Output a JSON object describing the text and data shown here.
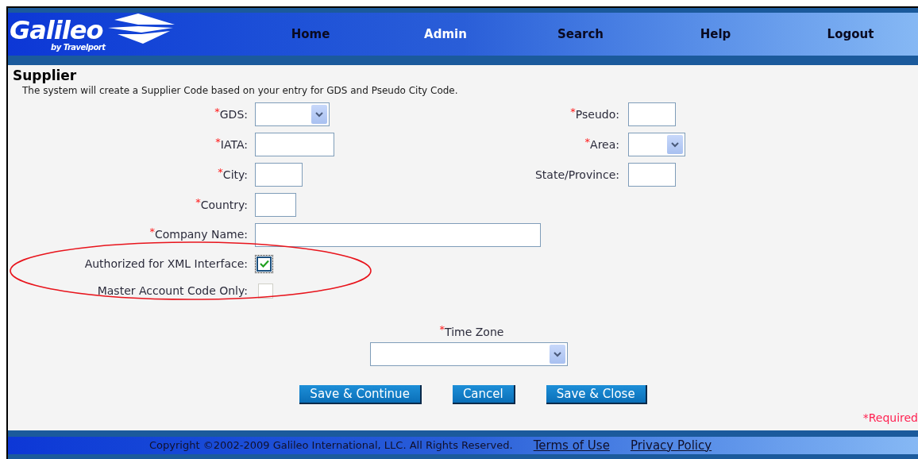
{
  "logo": {
    "name": "Galileo",
    "byline": "by Travelport"
  },
  "nav": [
    {
      "label": "Home",
      "selected": false
    },
    {
      "label": "Admin",
      "selected": true
    },
    {
      "label": "Search",
      "selected": false
    },
    {
      "label": "Help",
      "selected": false
    },
    {
      "label": "Logout",
      "selected": false
    }
  ],
  "page": {
    "title": "Supplier",
    "description": "The system will create a Supplier Code based on your entry for GDS and Pseudo City Code."
  },
  "form_rows": [
    {
      "left": {
        "kind": "select",
        "label": "GDS:",
        "required": true
      },
      "right": {
        "kind": "text",
        "label": "Pseudo:",
        "required": true
      }
    },
    {
      "left": {
        "kind": "text",
        "label": "IATA:",
        "required": true
      },
      "right": {
        "kind": "select",
        "label": "Area:",
        "required": true
      }
    },
    {
      "left": {
        "kind": "text",
        "label": "City:",
        "required": true
      },
      "right": {
        "kind": "text",
        "label": "State/Province:",
        "required": false
      }
    },
    {
      "left": {
        "kind": "text",
        "label": "Country:",
        "required": true
      }
    },
    {
      "left": {
        "kind": "text",
        "label": "Company Name:",
        "required": true
      }
    },
    {
      "left": {
        "kind": "checkbox",
        "label": "Authorized for XML Interface:",
        "required": false,
        "checked": true,
        "disabled": false
      }
    },
    {
      "left": {
        "kind": "checkbox",
        "label": "Master Account Code Only:",
        "required": false,
        "checked": false,
        "disabled": true
      }
    }
  ],
  "required_mark": "*",
  "time_zone": {
    "label": "Time Zone",
    "required": true
  },
  "buttons": [
    "Save & Continue",
    "Cancel",
    "Save & Close"
  ],
  "required_note": "Required",
  "footer": {
    "copyright": "Copyright ©2002-2009 Galileo International, LLC. All Rights Reserved.",
    "links": [
      "Terms of Use",
      "Privacy Policy"
    ]
  }
}
